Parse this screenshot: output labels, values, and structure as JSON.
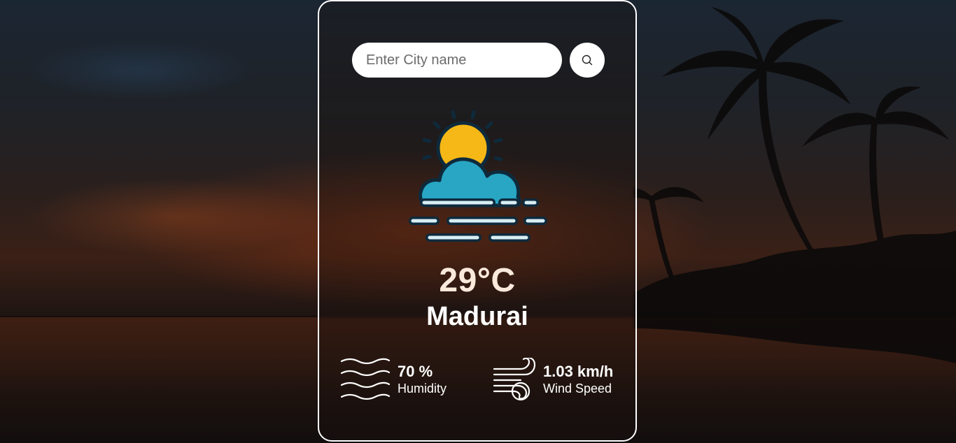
{
  "search": {
    "placeholder": "Enter City name",
    "value": ""
  },
  "weather": {
    "icon": "sun-behind-cloud-mist-icon",
    "temperature": "29°C",
    "city": "Madurai"
  },
  "details": {
    "humidity_value": "70 %",
    "humidity_label": "Humidity",
    "wind_value": "1.03 km/h",
    "wind_label": "Wind Speed"
  },
  "colors": {
    "card_border": "#ffffff",
    "temperature_text": "#fbe9dc",
    "sun": "#f5b817",
    "cloud": "#28a6c4",
    "outline": "#0e2a3c"
  }
}
